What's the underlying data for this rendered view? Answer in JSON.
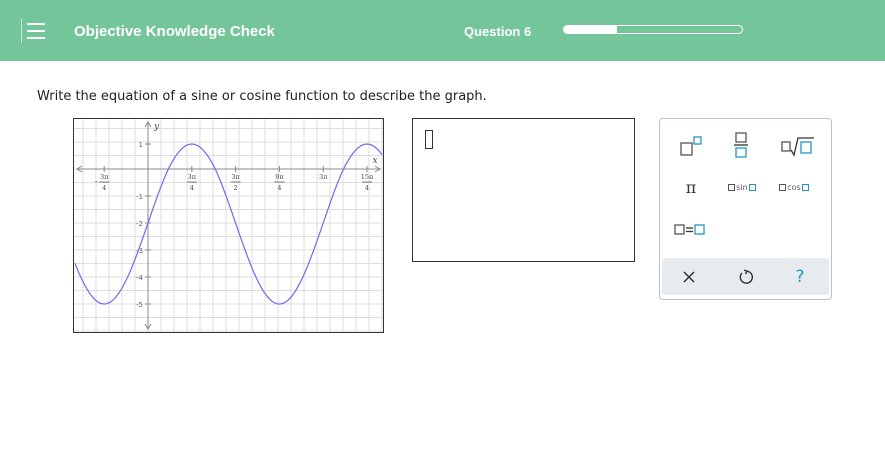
{
  "header": {
    "title": "Objective Knowledge Check",
    "question_label": "Question 6",
    "progress_fraction": 0.3
  },
  "prompt": "Write the equation of a sine or cosine function to describe the graph.",
  "graph": {
    "axis_x_label": "x",
    "axis_y_label": "y",
    "x_ticks": [
      {
        "num": "3π",
        "den": "4",
        "sign": "-"
      },
      {
        "num": "3π",
        "den": "4",
        "sign": ""
      },
      {
        "num": "3π",
        "den": "2",
        "sign": ""
      },
      {
        "num": "9π",
        "den": "4",
        "sign": ""
      },
      {
        "num": "3π",
        "den": "",
        "sign": ""
      },
      {
        "num": "15π",
        "den": "4",
        "sign": ""
      }
    ],
    "y_ticks": [
      "1",
      "-1",
      "-2",
      "-3",
      "-4",
      "-5"
    ],
    "curve_color": "#6b6bf0"
  },
  "palette": {
    "buttons": [
      "superscript",
      "fraction",
      "square-root",
      "pi",
      "sin",
      "cos",
      "equals"
    ],
    "pi_label": "π",
    "sin_label": "sin",
    "cos_label": "cos",
    "equals_label": "=",
    "help_label": "?"
  },
  "colors": {
    "header_bg": "#74c69a",
    "box_blue": "#2196c6"
  }
}
